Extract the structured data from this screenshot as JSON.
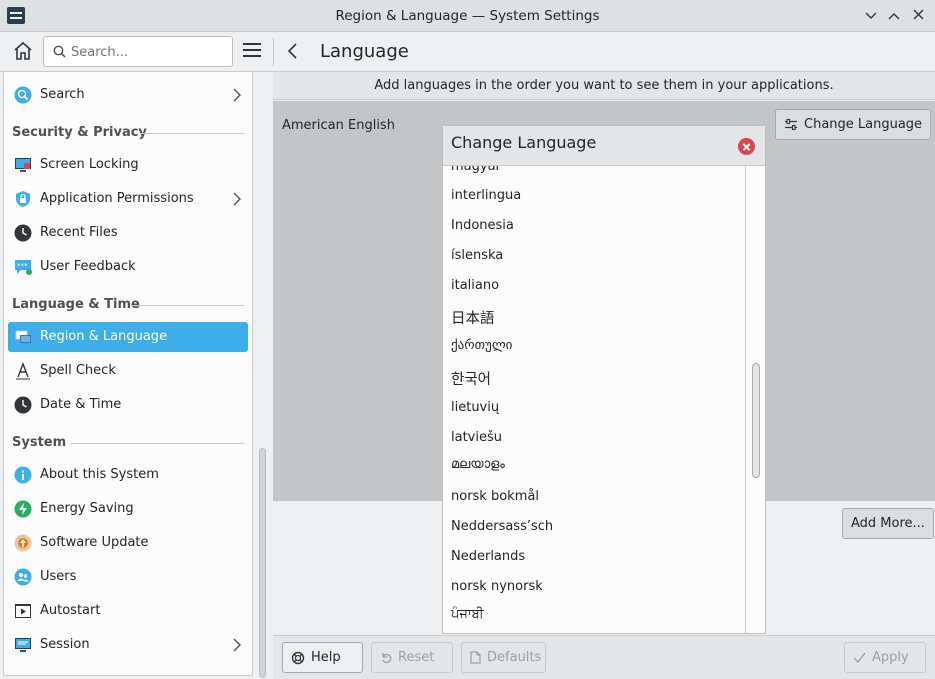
{
  "window": {
    "title": "Region & Language — System Settings"
  },
  "toolbar": {
    "search_placeholder": "Search...",
    "page_title": "Language"
  },
  "sidebar": {
    "search_item": "Search",
    "sections": {
      "security": "Security & Privacy",
      "language": "Language & Time",
      "system": "System"
    },
    "items": {
      "screen_locking": "Screen Locking",
      "app_permissions": "Application Permissions",
      "recent_files": "Recent Files",
      "user_feedback": "User Feedback",
      "region_language": "Region & Language",
      "spell_check": "Spell Check",
      "date_time": "Date & Time",
      "about": "About this System",
      "energy": "Energy Saving",
      "software_update": "Software Update",
      "users": "Users",
      "autostart": "Autostart",
      "session": "Session"
    }
  },
  "main": {
    "info": "Add languages in the order you want to see them in your applications.",
    "current_language": "American English",
    "change_language_button": "Change Language",
    "add_more_button": "Add More..."
  },
  "dialog": {
    "title": "Change Language",
    "languages": [
      "magyar",
      "interlingua",
      "Indonesia",
      "íslenska",
      "italiano",
      "日本語",
      "ქართული",
      "한국어",
      "lietuvių",
      "latviešu",
      "മലയാളം",
      "norsk bokmål",
      "Neddersass’sch",
      "Nederlands",
      "norsk nynorsk",
      "ਪੰਜਾਬੀ"
    ]
  },
  "bottom": {
    "help": "Help",
    "reset": "Reset",
    "defaults": "Defaults",
    "apply": "Apply"
  },
  "colors": {
    "accent": "#3daee9",
    "close_red": "#da4453"
  }
}
